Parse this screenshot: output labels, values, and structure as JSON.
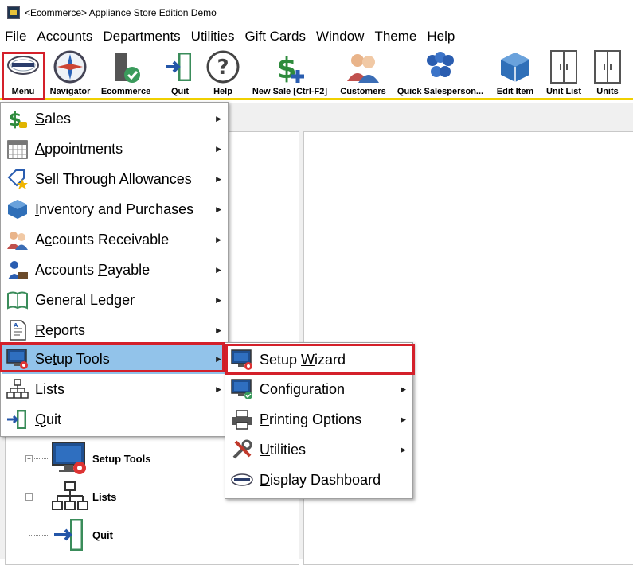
{
  "window": {
    "title": "<Ecommerce> Appliance Store Edition Demo"
  },
  "menubar": [
    "File",
    "Accounts",
    "Departments",
    "Utilities",
    "Gift Cards",
    "Window",
    "Theme",
    "Help"
  ],
  "toolbar": [
    {
      "label": "Menu",
      "icon": "windward-logo-icon"
    },
    {
      "label": "Navigator",
      "icon": "compass-icon"
    },
    {
      "label": "Ecommerce",
      "icon": "ecommerce-check-icon"
    },
    {
      "label": "Quit",
      "icon": "exit-door-icon"
    },
    {
      "label": "Help",
      "icon": "help-icon"
    },
    {
      "label": "New Sale [Ctrl-F2]",
      "icon": "dollar-plus-icon"
    },
    {
      "label": "Customers",
      "icon": "customers-icon"
    },
    {
      "label": "Quick Salesperson...",
      "icon": "salespeople-icon"
    },
    {
      "label": "Edit Item",
      "icon": "cube-icon"
    },
    {
      "label": "Unit List",
      "icon": "cabinet-icon"
    },
    {
      "label": "Units",
      "icon": "cabinet-icon"
    }
  ],
  "main_menu": [
    {
      "pre": "",
      "ul": "S",
      "post": "ales",
      "icon": "dollar-icon",
      "submenu": true
    },
    {
      "pre": "",
      "ul": "A",
      "post": "ppointments",
      "icon": "calendar-icon",
      "submenu": true
    },
    {
      "pre": "Se",
      "ul": "l",
      "post": "l Through Allowances",
      "icon": "tag-star-icon",
      "submenu": true
    },
    {
      "pre": "",
      "ul": "I",
      "post": "nventory and Purchases",
      "icon": "cube-icon",
      "submenu": true
    },
    {
      "pre": "A",
      "ul": "c",
      "post": "counts Receivable",
      "icon": "people-icon",
      "submenu": true
    },
    {
      "pre": "Accounts ",
      "ul": "P",
      "post": "ayable",
      "icon": "person-briefcase-icon",
      "submenu": true
    },
    {
      "pre": "General ",
      "ul": "L",
      "post": "edger",
      "icon": "book-icon",
      "submenu": true
    },
    {
      "pre": "",
      "ul": "R",
      "post": "eports",
      "icon": "report-icon",
      "submenu": true
    },
    {
      "pre": "Se",
      "ul": "t",
      "post": "up Tools",
      "icon": "monitor-gear-icon",
      "submenu": true
    },
    {
      "pre": "L",
      "ul": "i",
      "post": "sts",
      "icon": "hierarchy-icon",
      "submenu": true
    },
    {
      "pre": "",
      "ul": "Q",
      "post": "uit",
      "icon": "exit-door-icon",
      "submenu": false
    }
  ],
  "setup_submenu": [
    {
      "pre": "Setup ",
      "ul": "W",
      "post": "izard",
      "icon": "monitor-gear-icon",
      "submenu": false
    },
    {
      "pre": "",
      "ul": "C",
      "post": "onfiguration",
      "icon": "monitor-check-icon",
      "submenu": true
    },
    {
      "pre": "",
      "ul": "P",
      "post": "rinting Options",
      "icon": "printer-icon",
      "submenu": true
    },
    {
      "pre": "",
      "ul": "U",
      "post": "tilities",
      "icon": "tools-icon",
      "submenu": true
    },
    {
      "pre": "",
      "ul": "D",
      "post": "isplay Dashboard",
      "icon": "windward-logo-icon",
      "submenu": false
    }
  ],
  "tree": [
    {
      "label": "Setup Tools",
      "icon": "monitor-gear-icon"
    },
    {
      "label": "Lists",
      "icon": "hierarchy-icon"
    },
    {
      "label": "Quit",
      "icon": "exit-door-icon"
    }
  ],
  "colors": {
    "highlight": "#92c3ea",
    "callout": "#d4202a",
    "toolbar_border": "#f0d000"
  }
}
